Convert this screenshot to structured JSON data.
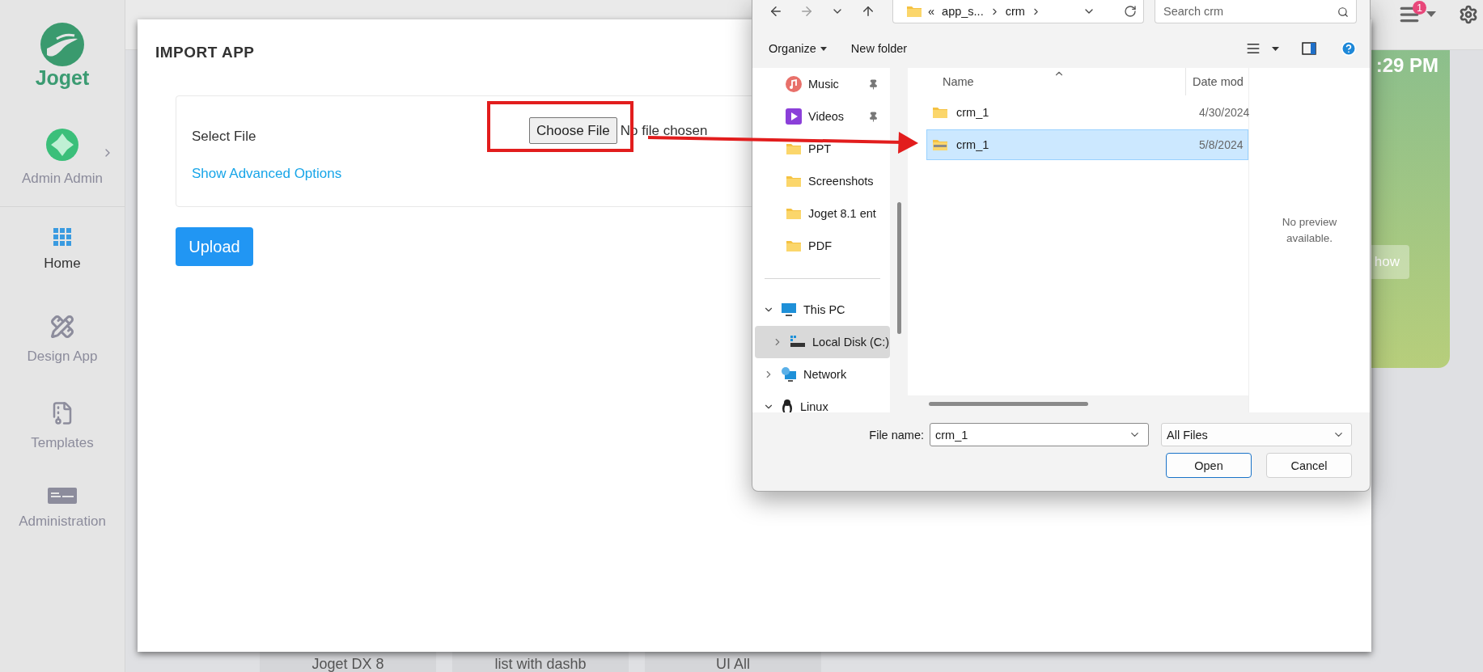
{
  "sidebar": {
    "logo_text": "Joget",
    "user": "Admin Admin",
    "items": [
      {
        "label": "Home",
        "kind": "home",
        "selected": true
      },
      {
        "label": "Design App",
        "kind": "design",
        "selected": false
      },
      {
        "label": "Templates",
        "kind": "templates",
        "selected": false
      },
      {
        "label": "Administration",
        "kind": "admin",
        "selected": false
      }
    ]
  },
  "page_header": {
    "notification_count": "1"
  },
  "dashboard": {
    "clock": ":29 PM",
    "card_button": "how",
    "tabs": [
      "Joget DX 8",
      "list with dashb",
      "UI All"
    ]
  },
  "modal": {
    "title": "IMPORT APP",
    "select_label": "Select File",
    "choose_button": "Choose File",
    "file_status": "No file chosen",
    "advanced_link": "Show Advanced Options",
    "upload_button": "Upload"
  },
  "file_dialog": {
    "path_overflow": "«",
    "breadcrumbs": [
      "app_s...",
      "crm"
    ],
    "search_placeholder": "Search crm",
    "commands": {
      "organize": "Organize",
      "new_folder": "New folder"
    },
    "nav": {
      "quick_access": [
        {
          "label": "Music",
          "kind": "music",
          "pinned": true
        },
        {
          "label": "Videos",
          "kind": "video",
          "pinned": true
        },
        {
          "label": "PPT",
          "kind": "folder",
          "pinned": false
        },
        {
          "label": "Screenshots",
          "kind": "folder",
          "pinned": false
        },
        {
          "label": "Joget 8.1 ent",
          "kind": "folder",
          "pinned": false
        },
        {
          "label": "PDF",
          "kind": "folder",
          "pinned": false
        }
      ],
      "tree": [
        {
          "label": "This PC",
          "kind": "pc",
          "expanded": true,
          "selected": false,
          "children": [
            {
              "label": "Local Disk (C:)",
              "kind": "disk",
              "expanded": false,
              "selected": true
            }
          ]
        },
        {
          "label": "Network",
          "kind": "network",
          "expanded": false,
          "selected": false
        },
        {
          "label": "Linux",
          "kind": "linux",
          "expanded": true,
          "selected": false
        }
      ]
    },
    "columns": [
      "Name",
      "Date mod"
    ],
    "files": [
      {
        "name": "crm_1",
        "date": "4/30/2024",
        "kind": "folder",
        "selected": false
      },
      {
        "name": "crm_1",
        "date": "5/8/2024",
        "kind": "zip",
        "selected": true
      }
    ],
    "preview": "No preview available.",
    "file_name_label": "File name:",
    "file_name": "crm_1",
    "file_type": "All Files",
    "open_button": "Open",
    "cancel_button": "Cancel"
  }
}
